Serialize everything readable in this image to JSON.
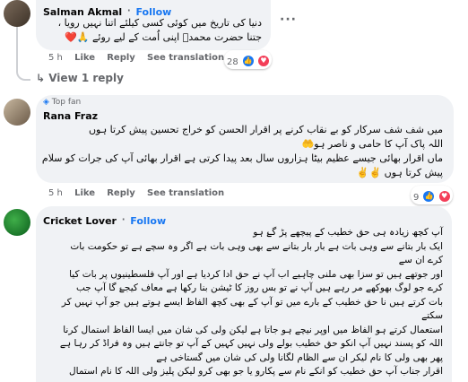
{
  "comments": [
    {
      "author": "Salman Akmal",
      "follow": "Follow",
      "lines": [
        "دنیا کی تاریخ میں کوئی کسی کیلئے اتنا نہیں رویا ،",
        "جتنا حضرت محمدؐ اپنی اُمت کے لیے روئے 🙏❤️"
      ],
      "time": "5 h",
      "like": "Like",
      "reply": "Reply",
      "translate": "See translation",
      "reaction_count": "28",
      "reply_link": "View 1 reply"
    },
    {
      "badge": "Top fan",
      "author": "Rana Fraz",
      "lines": [
        "میں شف شف سرکار کو بے نقاب کرنے پر اقرار الحسن کو خراج تحسین پیش کرتا ہوں",
        "اللہ پاک آپ کا حامی و ناصر ہو🤲",
        "ماں اقرار بھائی جیسے عظیم بیٹا ہزاروں سال بعد پیدا کرتی ہے اقرار بھائی آپ کی جرات کو سلام",
        "پیش کرتا ہوں ✌️✌️"
      ],
      "time": "5 h",
      "like": "Like",
      "reply": "Reply",
      "translate": "See translation",
      "reaction_count": "9"
    },
    {
      "author": "Cricket Lover",
      "follow": "Follow",
      "lines": [
        "آپ کچھ زیادہ ہی حق خطیب کے پیچھے پڑ گۓ ہو",
        "ایک بار بتانے سے وہی بات ہے بار بار بتانے سے بھی وہی بات ہے اگر وہ سچے ہے تو حکومت بات",
        "کرے ان سے",
        "اور جوتھے ہیں تو سزا بھی ملنی چاہیے اب آپ نے حق ادا کردیا ہے اور آپ فلسطینیوں پر بات کیا",
        "کرے جو لوگ بھوکھے مر رہے ہیں آپ نے تو بس روز کا ٹیشن بنا رکھا ہے معاف کیجۓ گا آپ جب",
        "بات کرتے ہیں نا حق خطیب کے بارے میں تو آپ کے بھی کچھ الفاظ ایسے ہوتے ہیں جو آپ نہیں کر سکتے",
        "استعمال کرتے ہو الفاظ میں اوپر نیچے ہو جاتا ہے لیکن ولی کی شان میں ایسا الفاظ استمال کرنا",
        "اللہ کو پسند نہیں آپ انکو حق خطیب بولے ولی نہیں کہیں کے آپ تو جانتے ہیں وہ فراڈ کر رہا ہے",
        "پھر بھی ولی کا نام لیکر ان سے الظام لگانا ولی کی شان میں گستاخی ہے",
        "اقرار جناب آپ حق خطیب کو انکے نام سے پکارو یا جو بھی کرو لیکن پلیز ولی اللہ کا نام استمال"
      ]
    }
  ],
  "colors": {
    "bubble": "#f0f2f5",
    "accent": "#1877f2",
    "muted": "#65676b",
    "like_blue": "#1877f2",
    "love_red": "#f33e58"
  },
  "icons": [
    "avatar",
    "like-reaction-icon",
    "love-reaction-icon",
    "reply-arrow-icon",
    "more-options-icon",
    "top-fan-badge-icon"
  ]
}
